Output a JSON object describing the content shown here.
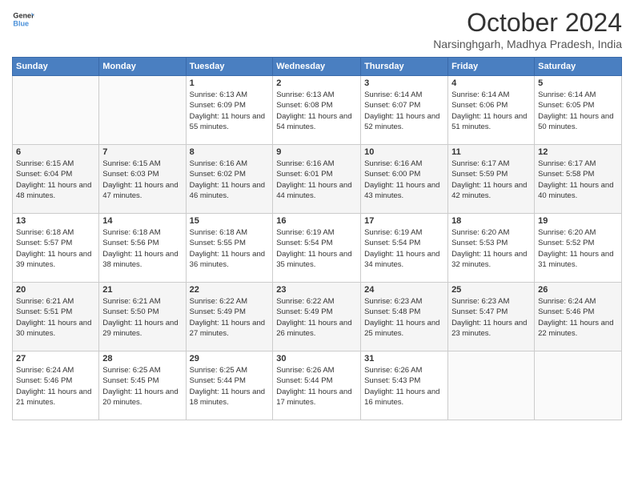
{
  "header": {
    "logo_line1": "General",
    "logo_line2": "Blue",
    "month_title": "October 2024",
    "subtitle": "Narsinghgarh, Madhya Pradesh, India"
  },
  "weekdays": [
    "Sunday",
    "Monday",
    "Tuesday",
    "Wednesday",
    "Thursday",
    "Friday",
    "Saturday"
  ],
  "weeks": [
    [
      {
        "day": "",
        "sunrise": "",
        "sunset": "",
        "daylight": ""
      },
      {
        "day": "",
        "sunrise": "",
        "sunset": "",
        "daylight": ""
      },
      {
        "day": "1",
        "sunrise": "Sunrise: 6:13 AM",
        "sunset": "Sunset: 6:09 PM",
        "daylight": "Daylight: 11 hours and 55 minutes."
      },
      {
        "day": "2",
        "sunrise": "Sunrise: 6:13 AM",
        "sunset": "Sunset: 6:08 PM",
        "daylight": "Daylight: 11 hours and 54 minutes."
      },
      {
        "day": "3",
        "sunrise": "Sunrise: 6:14 AM",
        "sunset": "Sunset: 6:07 PM",
        "daylight": "Daylight: 11 hours and 52 minutes."
      },
      {
        "day": "4",
        "sunrise": "Sunrise: 6:14 AM",
        "sunset": "Sunset: 6:06 PM",
        "daylight": "Daylight: 11 hours and 51 minutes."
      },
      {
        "day": "5",
        "sunrise": "Sunrise: 6:14 AM",
        "sunset": "Sunset: 6:05 PM",
        "daylight": "Daylight: 11 hours and 50 minutes."
      }
    ],
    [
      {
        "day": "6",
        "sunrise": "Sunrise: 6:15 AM",
        "sunset": "Sunset: 6:04 PM",
        "daylight": "Daylight: 11 hours and 48 minutes."
      },
      {
        "day": "7",
        "sunrise": "Sunrise: 6:15 AM",
        "sunset": "Sunset: 6:03 PM",
        "daylight": "Daylight: 11 hours and 47 minutes."
      },
      {
        "day": "8",
        "sunrise": "Sunrise: 6:16 AM",
        "sunset": "Sunset: 6:02 PM",
        "daylight": "Daylight: 11 hours and 46 minutes."
      },
      {
        "day": "9",
        "sunrise": "Sunrise: 6:16 AM",
        "sunset": "Sunset: 6:01 PM",
        "daylight": "Daylight: 11 hours and 44 minutes."
      },
      {
        "day": "10",
        "sunrise": "Sunrise: 6:16 AM",
        "sunset": "Sunset: 6:00 PM",
        "daylight": "Daylight: 11 hours and 43 minutes."
      },
      {
        "day": "11",
        "sunrise": "Sunrise: 6:17 AM",
        "sunset": "Sunset: 5:59 PM",
        "daylight": "Daylight: 11 hours and 42 minutes."
      },
      {
        "day": "12",
        "sunrise": "Sunrise: 6:17 AM",
        "sunset": "Sunset: 5:58 PM",
        "daylight": "Daylight: 11 hours and 40 minutes."
      }
    ],
    [
      {
        "day": "13",
        "sunrise": "Sunrise: 6:18 AM",
        "sunset": "Sunset: 5:57 PM",
        "daylight": "Daylight: 11 hours and 39 minutes."
      },
      {
        "day": "14",
        "sunrise": "Sunrise: 6:18 AM",
        "sunset": "Sunset: 5:56 PM",
        "daylight": "Daylight: 11 hours and 38 minutes."
      },
      {
        "day": "15",
        "sunrise": "Sunrise: 6:18 AM",
        "sunset": "Sunset: 5:55 PM",
        "daylight": "Daylight: 11 hours and 36 minutes."
      },
      {
        "day": "16",
        "sunrise": "Sunrise: 6:19 AM",
        "sunset": "Sunset: 5:54 PM",
        "daylight": "Daylight: 11 hours and 35 minutes."
      },
      {
        "day": "17",
        "sunrise": "Sunrise: 6:19 AM",
        "sunset": "Sunset: 5:54 PM",
        "daylight": "Daylight: 11 hours and 34 minutes."
      },
      {
        "day": "18",
        "sunrise": "Sunrise: 6:20 AM",
        "sunset": "Sunset: 5:53 PM",
        "daylight": "Daylight: 11 hours and 32 minutes."
      },
      {
        "day": "19",
        "sunrise": "Sunrise: 6:20 AM",
        "sunset": "Sunset: 5:52 PM",
        "daylight": "Daylight: 11 hours and 31 minutes."
      }
    ],
    [
      {
        "day": "20",
        "sunrise": "Sunrise: 6:21 AM",
        "sunset": "Sunset: 5:51 PM",
        "daylight": "Daylight: 11 hours and 30 minutes."
      },
      {
        "day": "21",
        "sunrise": "Sunrise: 6:21 AM",
        "sunset": "Sunset: 5:50 PM",
        "daylight": "Daylight: 11 hours and 29 minutes."
      },
      {
        "day": "22",
        "sunrise": "Sunrise: 6:22 AM",
        "sunset": "Sunset: 5:49 PM",
        "daylight": "Daylight: 11 hours and 27 minutes."
      },
      {
        "day": "23",
        "sunrise": "Sunrise: 6:22 AM",
        "sunset": "Sunset: 5:49 PM",
        "daylight": "Daylight: 11 hours and 26 minutes."
      },
      {
        "day": "24",
        "sunrise": "Sunrise: 6:23 AM",
        "sunset": "Sunset: 5:48 PM",
        "daylight": "Daylight: 11 hours and 25 minutes."
      },
      {
        "day": "25",
        "sunrise": "Sunrise: 6:23 AM",
        "sunset": "Sunset: 5:47 PM",
        "daylight": "Daylight: 11 hours and 23 minutes."
      },
      {
        "day": "26",
        "sunrise": "Sunrise: 6:24 AM",
        "sunset": "Sunset: 5:46 PM",
        "daylight": "Daylight: 11 hours and 22 minutes."
      }
    ],
    [
      {
        "day": "27",
        "sunrise": "Sunrise: 6:24 AM",
        "sunset": "Sunset: 5:46 PM",
        "daylight": "Daylight: 11 hours and 21 minutes."
      },
      {
        "day": "28",
        "sunrise": "Sunrise: 6:25 AM",
        "sunset": "Sunset: 5:45 PM",
        "daylight": "Daylight: 11 hours and 20 minutes."
      },
      {
        "day": "29",
        "sunrise": "Sunrise: 6:25 AM",
        "sunset": "Sunset: 5:44 PM",
        "daylight": "Daylight: 11 hours and 18 minutes."
      },
      {
        "day": "30",
        "sunrise": "Sunrise: 6:26 AM",
        "sunset": "Sunset: 5:44 PM",
        "daylight": "Daylight: 11 hours and 17 minutes."
      },
      {
        "day": "31",
        "sunrise": "Sunrise: 6:26 AM",
        "sunset": "Sunset: 5:43 PM",
        "daylight": "Daylight: 11 hours and 16 minutes."
      },
      {
        "day": "",
        "sunrise": "",
        "sunset": "",
        "daylight": ""
      },
      {
        "day": "",
        "sunrise": "",
        "sunset": "",
        "daylight": ""
      }
    ]
  ]
}
